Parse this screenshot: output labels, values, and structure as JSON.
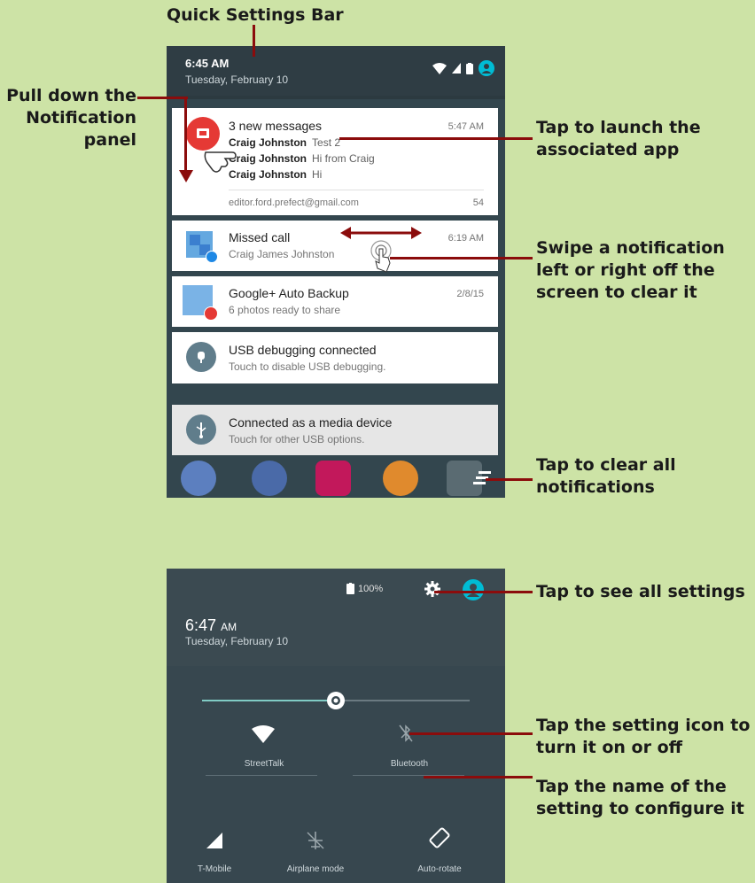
{
  "callouts": {
    "quick_settings_bar": "Quick Settings Bar",
    "pull_down_1": "Pull down the",
    "pull_down_2": "Notification",
    "pull_down_3": "panel",
    "tap_launch_1": "Tap to launch the",
    "tap_launch_2": "associated app",
    "swipe_1": "Swipe a notification",
    "swipe_2": "left or right off the",
    "swipe_3": "screen to clear it",
    "clear_all_1": "Tap to clear all",
    "clear_all_2": "notifications",
    "see_settings": "Tap to see all settings",
    "setting_icon_1": "Tap the setting icon to",
    "setting_icon_2": "turn it on or off",
    "setting_name_1": "Tap the name of the",
    "setting_name_2": "setting to configure it"
  },
  "phone1": {
    "time": "6:45 AM",
    "date": "Tuesday, February 10",
    "notifications": [
      {
        "title": "3 new messages",
        "time": "5:47 AM",
        "messages": [
          {
            "name": "Craig Johnston",
            "text": "Test 2"
          },
          {
            "name": "Craig Johnston",
            "text": "Hi from Craig"
          },
          {
            "name": "Craig Johnston",
            "text": "Hi"
          }
        ],
        "account": "editor.ford.prefect@gmail.com",
        "count": "54"
      },
      {
        "title": "Missed call",
        "subtitle": "Craig James Johnston",
        "time": "6:19 AM"
      },
      {
        "title": "Google+ Auto Backup",
        "subtitle": "6 photos ready to share",
        "time": "2/8/15"
      },
      {
        "title": "USB debugging connected",
        "subtitle": "Touch to disable USB debugging."
      },
      {
        "title": "Connected as a media device",
        "subtitle": "Touch for other USB options."
      }
    ]
  },
  "phone2": {
    "battery": "100%",
    "time": "6:47",
    "ampm": "AM",
    "date": "Tuesday, February 10",
    "brightness": 0.5,
    "tiles": [
      {
        "label": "StreetTalk"
      },
      {
        "label": "Bluetooth"
      },
      {
        "label": "T-Mobile"
      },
      {
        "label": "Airplane mode"
      },
      {
        "label": "Auto-rotate"
      }
    ]
  },
  "colors": {
    "background": "#cde3a6",
    "callout_line": "#8b0c0c",
    "accent": "#00bcd4"
  }
}
